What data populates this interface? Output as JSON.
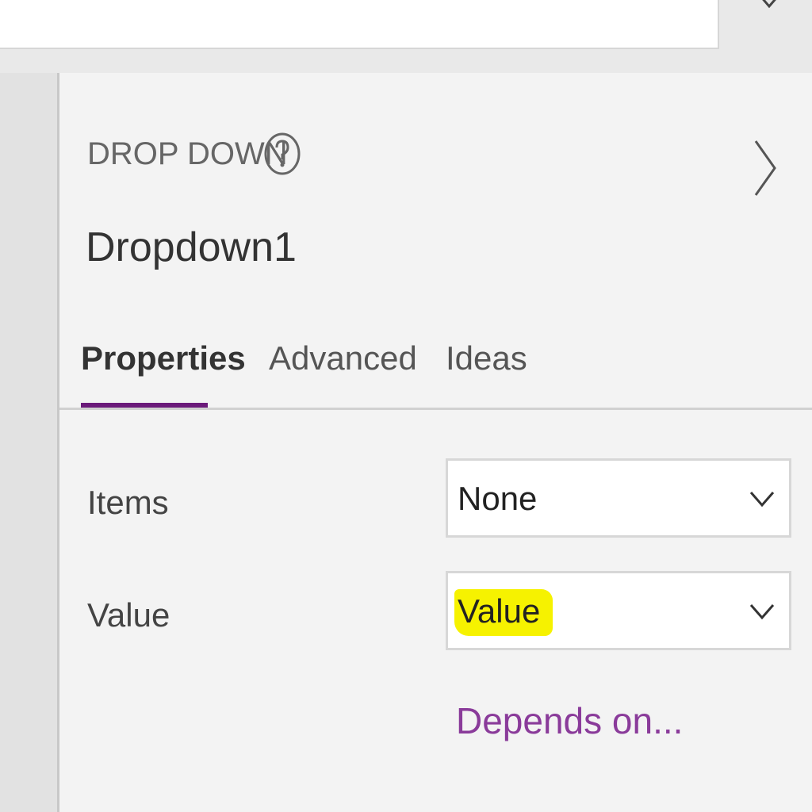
{
  "panel": {
    "control_type": "DROP DOWN",
    "control_name": "Dropdown1",
    "tabs": [
      {
        "label": "Properties",
        "active": true
      },
      {
        "label": "Advanced",
        "active": false
      },
      {
        "label": "Ideas",
        "active": false
      }
    ],
    "properties": {
      "items": {
        "label": "Items",
        "value": "None"
      },
      "value": {
        "label": "Value",
        "value": "Value"
      }
    },
    "depends_link": "Depends on..."
  },
  "icons": {
    "help": "help-circle-icon",
    "expand": "chevron-right-icon",
    "dropdown": "chevron-down-icon"
  },
  "colors": {
    "accent": "#6b1a7a",
    "link": "#8a3b9a",
    "highlight": "#f6f200"
  }
}
